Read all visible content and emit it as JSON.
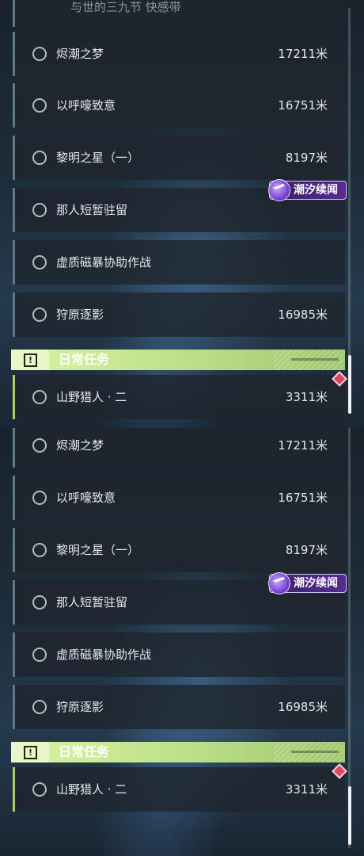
{
  "top": {
    "cut_off_label": "与世的三九节 快感带",
    "quests": [
      {
        "name": "烬潮之梦",
        "distance": "17211米"
      },
      {
        "name": "以呼嚎致意",
        "distance": "16751米"
      },
      {
        "name": "黎明之星（一）",
        "distance": "8197米"
      },
      {
        "name": "那人短暂驻留",
        "distance": ""
      },
      {
        "name": "虚质磁暴协助作战",
        "distance": ""
      },
      {
        "name": "狩原逐影",
        "distance": "16985米"
      }
    ],
    "section_title": "日常任务",
    "daily": {
      "name": "山野猎人 · 二",
      "distance": "3311米"
    },
    "badge_text": "潮汐续闻"
  },
  "bottom": {
    "quests": [
      {
        "name": "烬潮之梦",
        "distance": "17211米"
      },
      {
        "name": "以呼嚎致意",
        "distance": "16751米"
      },
      {
        "name": "黎明之星（一）",
        "distance": "8197米"
      },
      {
        "name": "那人短暂驻留",
        "distance": ""
      },
      {
        "name": "虚质磁暴协助作战",
        "distance": ""
      },
      {
        "name": "狩原逐影",
        "distance": "16985米"
      }
    ],
    "section_title": "日常任务",
    "daily": {
      "name": "山野猎人 · 二",
      "distance": "3311米"
    },
    "badge_text": "潮汐续闻"
  },
  "colors": {
    "quest_border": "#5b7b8d",
    "daily_border": "#a9cf72",
    "section_bg": "#c4e58f",
    "badge_bg": "#5a2d96",
    "marker": "#e0455e"
  },
  "icons": {
    "section_icon": "exclamation-box-icon",
    "radio": "radio-circle-icon",
    "badge_logo": "tide-logo-icon",
    "marker": "map-marker-diamond-icon"
  }
}
